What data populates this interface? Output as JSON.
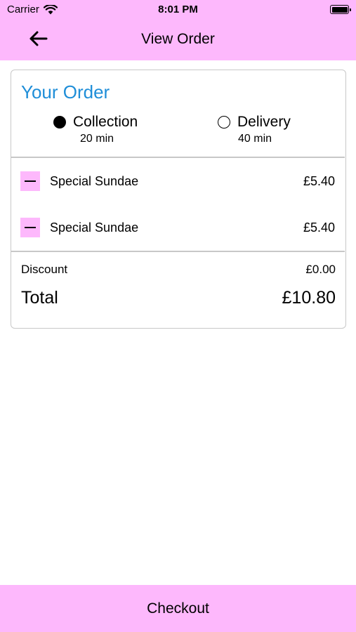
{
  "status_bar": {
    "carrier": "Carrier",
    "time": "8:01 PM",
    "battery_level_percent": 100
  },
  "nav": {
    "title": "View Order",
    "back_icon": "arrow-left-icon"
  },
  "order": {
    "heading": "Your Order",
    "options": [
      {
        "label": "Collection",
        "time": "20 min",
        "selected": true
      },
      {
        "label": "Delivery",
        "time": "40 min",
        "selected": false
      }
    ],
    "items": [
      {
        "name": "Special Sundae",
        "price": "£5.40",
        "remove_icon": "minus-icon"
      },
      {
        "name": "Special Sundae",
        "price": "£5.40",
        "remove_icon": "minus-icon"
      }
    ],
    "discount_label": "Discount",
    "discount_value": "£0.00",
    "total_label": "Total",
    "total_value": "£10.80"
  },
  "checkout_label": "Checkout",
  "colors": {
    "accent_pink": "#fdb8fc",
    "heading_blue": "#1f8ed8",
    "border_gray": "#c8c8c8"
  }
}
